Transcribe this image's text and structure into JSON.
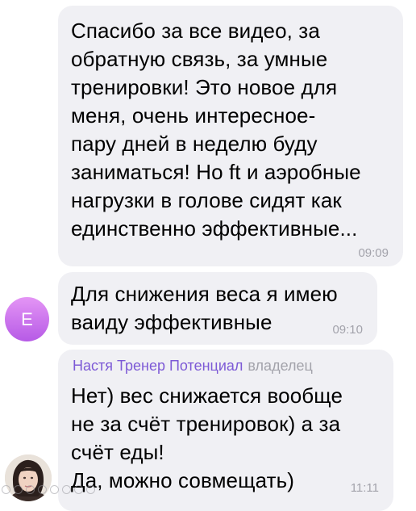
{
  "messages": [
    {
      "text": "Спасибо за все видео, за\nобратную связь, за умные\nтренировки! Это новое для\nменя, очень интересное-\nпару дней в неделю буду\nзаниматься! Но ft и аэробные\nнагрузки в голове сидят как\nединственно эффективные...",
      "time": "09:09"
    },
    {
      "text": "Для снижения веса я имею\nваиду эффективные",
      "time": "09:10",
      "avatar_letter": "E"
    },
    {
      "sender": "Настя Тренер Потенциал",
      "role": "владелец",
      "text": "Нет) вес снижается вообще\nне за счёт тренировок) а за\nсчёт еды!\nДа, можно совмещать)",
      "time": "11:11"
    }
  ],
  "colors": {
    "bubble": "#f0f0f4",
    "sender_name": "#7d5ad6",
    "avatar_gradient_top": "#e495f5",
    "avatar_gradient_bottom": "#b65ae6",
    "muted": "#a3a3ab"
  }
}
